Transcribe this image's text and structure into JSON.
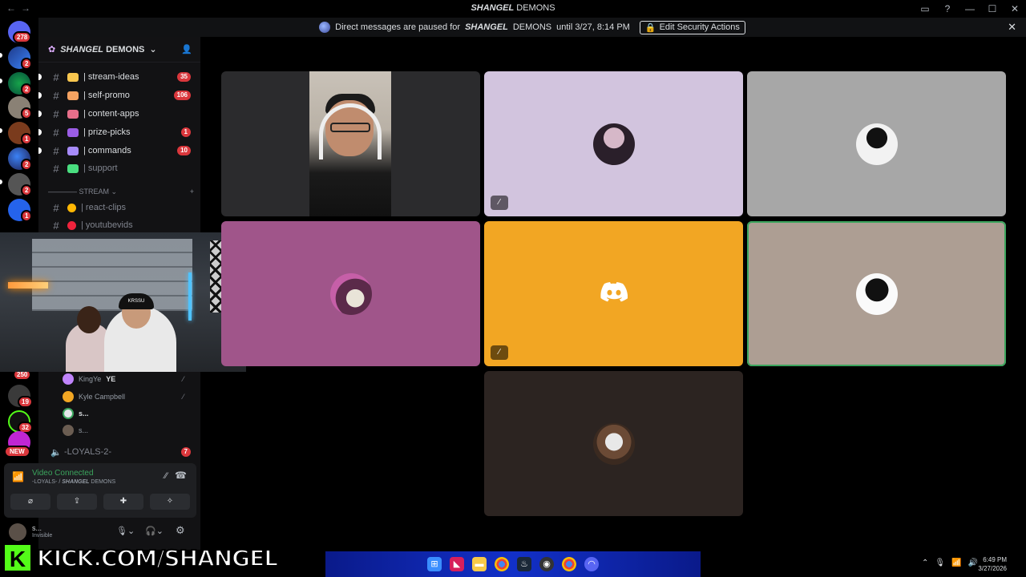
{
  "titlebar": {
    "back": "←",
    "forward": "→",
    "title_styled": "SHANGEL",
    "title_rest": " DEMONS",
    "window_controls": [
      "▭",
      "?",
      "—",
      "☐",
      "✕"
    ]
  },
  "banner": {
    "text_before": "Direct messages are paused for",
    "server_styled": "SHANGEL",
    "server_rest": "DEMONS",
    "text_after": "until 3/27, 8:14 PM",
    "button_label": "Edit Security Actions",
    "close": "✕"
  },
  "rail": {
    "home_badge": "278",
    "badges": [
      "2",
      "2",
      "5",
      "1",
      "2",
      "2",
      "1"
    ],
    "badge_250": "250",
    "badge_19": "19",
    "badge_32": "32",
    "new_label": "NEW"
  },
  "server": {
    "name_styled": "SHANGEL",
    "name_rest": "DEMONS"
  },
  "channels": [
    {
      "name": "| stream-ideas",
      "count": "35",
      "color": "#f9c74f"
    },
    {
      "name": "| self-promo",
      "count": "106",
      "color": "#f4a261"
    },
    {
      "name": "| content-apps",
      "count": "",
      "color": "#e76f8a"
    },
    {
      "name": "| prize-picks",
      "count": "1",
      "color": "#9b5de5"
    },
    {
      "name": "| commands",
      "count": "10",
      "color": "#a78bfa"
    },
    {
      "name": "| support",
      "count": "",
      "color": "#4ade80"
    }
  ],
  "stream_category": "STREAM",
  "stream_channels": [
    {
      "name": "| react-clips",
      "color": "#ffb703"
    },
    {
      "name": "| youtubevids",
      "color": "#ef233c"
    }
  ],
  "voice_users": [
    {
      "name": "KingYe",
      "tag": "YE"
    },
    {
      "name": "Kyle Campbell",
      "tag": ""
    },
    {
      "name": "s...",
      "tag": ""
    },
    {
      "name": "s...",
      "tag": ""
    }
  ],
  "voice_channel": {
    "name": "-LOYALS-2-",
    "count": "7"
  },
  "voice_panel": {
    "status": "Video Connected",
    "sub_prefix": "-LOYALS- / ",
    "sub_styled": "SHANGEL",
    "sub_rest": " DEMONS",
    "buttons": [
      "⌀",
      "⇪",
      "✚",
      "✧"
    ]
  },
  "user_panel": {
    "name": "s...",
    "status": "Invisible"
  },
  "kick": {
    "logo": "K",
    "url": "KICK.COM/SHANGEL"
  },
  "tray": {
    "time": "6:49 PM",
    "date": "3/27/2026"
  },
  "colors": {
    "tile_dark": "#2b2b2d",
    "tile_lavender": "#d2c4de",
    "tile_gray": "#a7a7a7",
    "tile_magenta": "#a0558a",
    "tile_orange": "#f2a623",
    "tile_taupe": "#ad9e93",
    "tile_brown": "#2c2421"
  }
}
